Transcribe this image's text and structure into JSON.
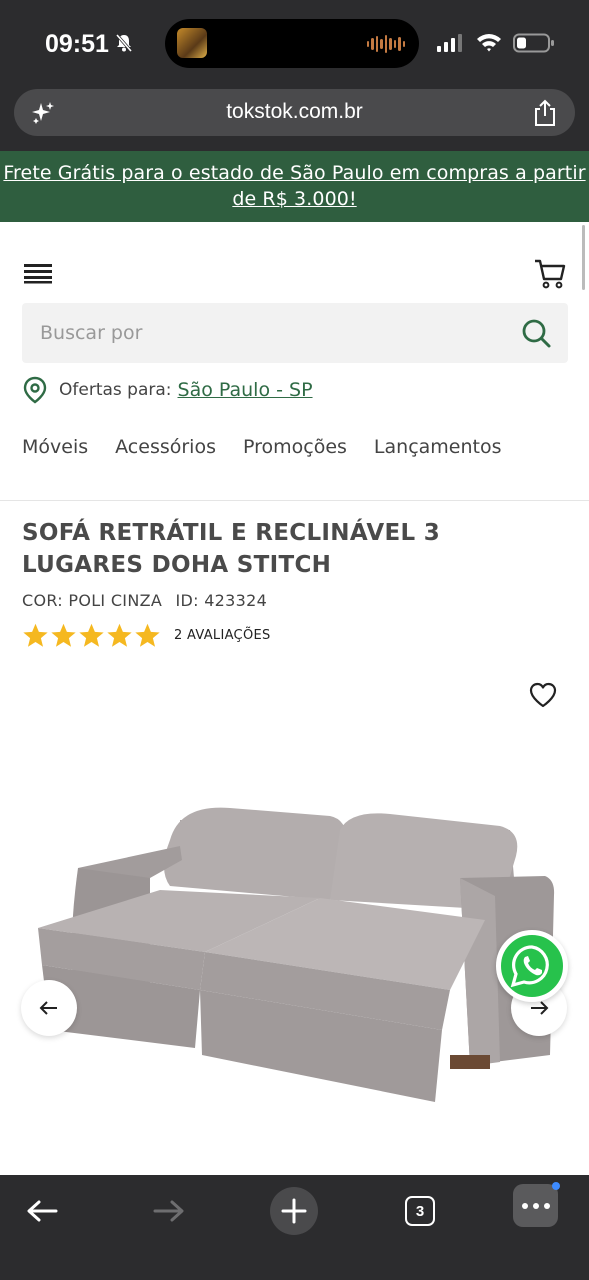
{
  "status_bar": {
    "time": "09:51"
  },
  "browser": {
    "url": "tokstok.com.br",
    "tab_count": "3"
  },
  "promo": {
    "text": "Frete Grátis para o estado de São Paulo em compras a partir de R$ 3.000!"
  },
  "search": {
    "placeholder": "Buscar por"
  },
  "location": {
    "label": "Ofertas para:",
    "value": "São Paulo - SP"
  },
  "nav": {
    "items": [
      "Móveis",
      "Acessórios",
      "Promoções",
      "Lançamentos"
    ]
  },
  "product": {
    "title": "SOFÁ RETRÁTIL E RECLINÁVEL 3 LUGARES DOHA STITCH",
    "color": "COR: POLI CINZA",
    "id": "ID: 423324",
    "rating": 5,
    "reviews": "2 AVALIAÇÕES"
  },
  "colors": {
    "brand_green": "#2f5e3f",
    "star": "#f5b820",
    "whatsapp": "#27c24c"
  }
}
